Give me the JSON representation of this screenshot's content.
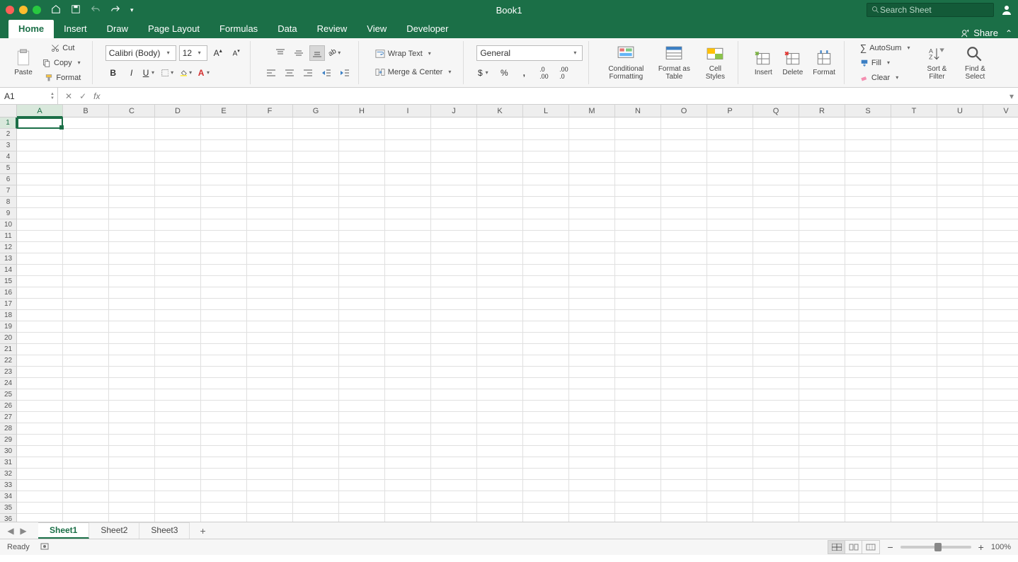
{
  "title": "Book1",
  "search": {
    "placeholder": "Search Sheet"
  },
  "tabs": [
    "Home",
    "Insert",
    "Draw",
    "Page Layout",
    "Formulas",
    "Data",
    "Review",
    "View",
    "Developer"
  ],
  "active_tab": "Home",
  "share_label": "Share",
  "clipboard": {
    "paste": "Paste",
    "cut": "Cut",
    "copy": "Copy",
    "format": "Format"
  },
  "font": {
    "name": "Calibri (Body)",
    "size": "12"
  },
  "wrap": "Wrap Text",
  "merge": "Merge & Center",
  "number_format": "General",
  "styles": {
    "cond": "Conditional Formatting",
    "table": "Format as Table",
    "cell": "Cell Styles"
  },
  "cells_group": {
    "insert": "Insert",
    "delete": "Delete",
    "format": "Format"
  },
  "editing": {
    "autosum": "AutoSum",
    "fill": "Fill",
    "clear": "Clear",
    "sort": "Sort & Filter",
    "find": "Find & Select"
  },
  "name_box": "A1",
  "columns": [
    "A",
    "B",
    "C",
    "D",
    "E",
    "F",
    "G",
    "H",
    "I",
    "J",
    "K",
    "L",
    "M",
    "N",
    "O",
    "P",
    "Q",
    "R",
    "S",
    "T",
    "U",
    "V"
  ],
  "rows": 36,
  "sheet_tabs": [
    "Sheet1",
    "Sheet2",
    "Sheet3"
  ],
  "active_sheet": "Sheet1",
  "status": {
    "ready": "Ready",
    "zoom": "100%"
  }
}
